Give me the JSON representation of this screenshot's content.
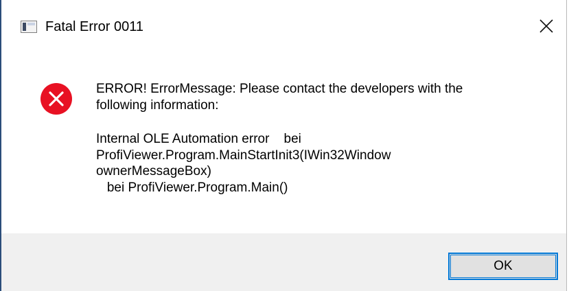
{
  "window": {
    "title": "Fatal Error 0011",
    "app_icon": "application-window-icon",
    "close_icon": "close-icon"
  },
  "message": {
    "icon": "error-circle-x-icon",
    "line1": "ERROR! ErrorMessage: Please contact the developers with the",
    "line2": "following information:",
    "line3": "Internal OLE Automation error    bei",
    "line4": "ProfiViewer.Program.MainStartInit3(IWin32Window",
    "line5": "ownerMessageBox)",
    "line6": "   bei ProfiViewer.Program.Main()"
  },
  "buttons": {
    "ok_label": "OK"
  },
  "colors": {
    "error_red": "#e81123",
    "accent_blue": "#0078d7",
    "footer_bg": "#f0f0f0"
  }
}
